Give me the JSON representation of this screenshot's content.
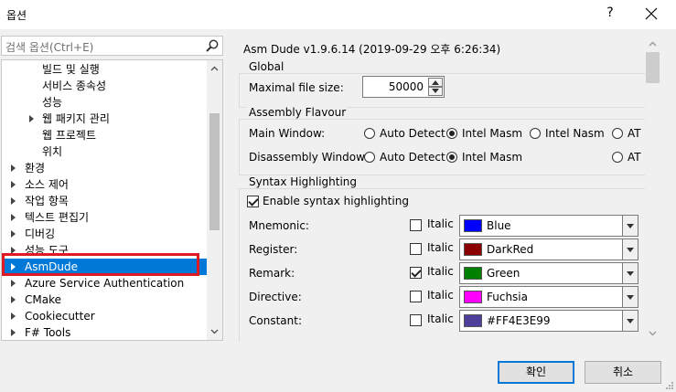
{
  "window": {
    "title": "옵션",
    "help_label": "?"
  },
  "search": {
    "placeholder": "검색 옵션(Ctrl+E)"
  },
  "tree": {
    "items": [
      {
        "label": "빌드 및 실행",
        "indent": 2,
        "arrow": false
      },
      {
        "label": "서비스 종속성",
        "indent": 2,
        "arrow": false
      },
      {
        "label": "성능",
        "indent": 2,
        "arrow": false
      },
      {
        "label": "웹 패키지 관리",
        "indent": 2,
        "arrow": true
      },
      {
        "label": "웹 프로젝트",
        "indent": 2,
        "arrow": false
      },
      {
        "label": "위치",
        "indent": 2,
        "arrow": false
      },
      {
        "label": "환경",
        "indent": 0,
        "arrow": true
      },
      {
        "label": "소스 제어",
        "indent": 0,
        "arrow": true
      },
      {
        "label": "작업 항목",
        "indent": 0,
        "arrow": true
      },
      {
        "label": "텍스트 편집기",
        "indent": 0,
        "arrow": true
      },
      {
        "label": "디버깅",
        "indent": 0,
        "arrow": true
      },
      {
        "label": "성능 도구",
        "indent": 0,
        "arrow": true
      },
      {
        "label": "AsmDude",
        "indent": 0,
        "arrow": true,
        "selected": true
      },
      {
        "label": "Azure Service Authentication",
        "indent": 0,
        "arrow": true
      },
      {
        "label": "CMake",
        "indent": 0,
        "arrow": true
      },
      {
        "label": "Cookiecutter",
        "indent": 0,
        "arrow": true
      },
      {
        "label": "F# Tools",
        "indent": 0,
        "arrow": true
      }
    ]
  },
  "panel": {
    "title": "Asm Dude v1.9.6.14 (2019-09-29 오후 6:26:34)",
    "global": {
      "label": "Global",
      "max_file_size_label": "Maximal file size:",
      "max_file_size_value": "50000"
    },
    "assembly": {
      "label": "Assembly Flavour",
      "main_window_label": "Main Window:",
      "disassembly_window_label": "Disassembly Window:",
      "opt_auto": "Auto Detect",
      "opt_intel_masm": "Intel Masm",
      "opt_intel_nasm": "Intel Nasm",
      "opt_at": "AT"
    },
    "syntax": {
      "label": "Syntax Highlighting",
      "enable_label": "Enable syntax highlighting",
      "italic_label": "Italic",
      "rows": [
        {
          "name": "Mnemonic:",
          "italic": false,
          "color_name": "Blue",
          "color": "#0000ff"
        },
        {
          "name": "Register:",
          "italic": false,
          "color_name": "DarkRed",
          "color": "#8b0000"
        },
        {
          "name": "Remark:",
          "italic": true,
          "color_name": "Green",
          "color": "#008000"
        },
        {
          "name": "Directive:",
          "italic": false,
          "color_name": "Fuchsia",
          "color": "#ff00ff"
        },
        {
          "name": "Constant:",
          "italic": false,
          "color_name": "#FF4E3E99",
          "color": "#4e3e99"
        }
      ]
    }
  },
  "buttons": {
    "ok": "확인",
    "cancel": "취소"
  }
}
